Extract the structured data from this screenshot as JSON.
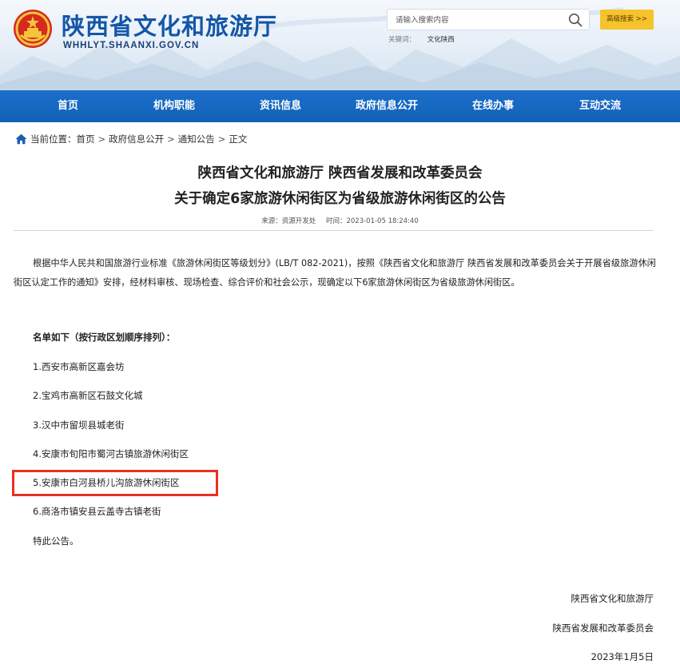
{
  "site": {
    "title": "陕西省文化和旅游厅",
    "domain": "WHHLYT.SHAANXI.GOV.CN"
  },
  "search": {
    "placeholder": "请输入搜索内容",
    "advanced_label": "高级搜索 >>",
    "hot_label": "关键词：",
    "hot_word": "文化陕西"
  },
  "nav": {
    "items": [
      "首页",
      "机构职能",
      "资讯信息",
      "政府信息公开",
      "在线办事",
      "互动交流"
    ]
  },
  "breadcrumb": {
    "prefix": "当前位置：",
    "items": [
      "首页",
      "政府信息公开",
      "通知公告",
      "正文"
    ],
    "separator": ">"
  },
  "article": {
    "title_line1": "陕西省文化和旅游厅 陕西省发展和改革委员会",
    "title_line2": "关于确定6家旅游休闲街区为省级旅游休闲街区的公告",
    "source": "来源：资源开发处",
    "time": "时间：2023-01-05 18:24:40",
    "body": "根据中华人民共和国旅游行业标准《旅游休闲街区等级划分》(LB/T 082-2021)，按照《陕西省文化和旅游厅 陕西省发展和改革委员会关于开展省级旅游休闲街区认定工作的通知》安排，经材料审核、现场检查、综合评价和社会公示，现确定以下6家旅游休闲街区为省级旅游休闲街区。",
    "list_heading": "名单如下（按行政区划顺序排列）：",
    "list": [
      "1.西安市高新区嘉会坊",
      "2.宝鸡市高新区石鼓文化城",
      "3.汉中市留坝县城老街",
      "4.安康市旬阳市蜀河古镇旅游休闲街区",
      "5.安康市白河县桥儿沟旅游休闲街区",
      "6.商洛市镇安县云盖寺古镇老街"
    ],
    "closing": "特此公告。",
    "signer1": "陕西省文化和旅游厅",
    "signer2": "陕西省发展和改革委员会",
    "date": "2023年1月5日"
  },
  "colors": {
    "nav_bg": "#1565c0",
    "title_blue": "#1456a8",
    "adv_button": "#f6c32c",
    "highlight": "#e8311f"
  },
  "icons": [
    "national-emblem-icon",
    "search-icon",
    "home-icon"
  ]
}
